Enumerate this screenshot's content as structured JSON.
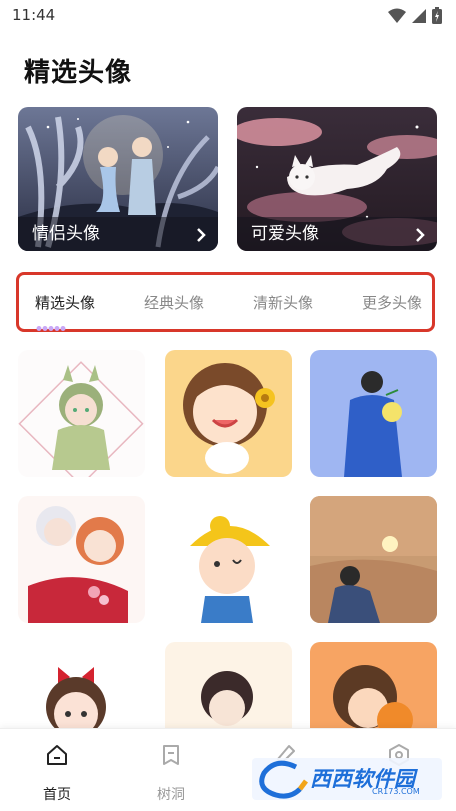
{
  "status_bar": {
    "time": "11:44"
  },
  "page_title": "精选头像",
  "banners": [
    {
      "label": "情侣头像",
      "icon": "chevron-right-icon"
    },
    {
      "label": "可爱头像",
      "icon": "chevron-right-icon"
    }
  ],
  "tabs": [
    {
      "label": "精选头像",
      "active": true
    },
    {
      "label": "经典头像",
      "active": false
    },
    {
      "label": "清新头像",
      "active": false
    },
    {
      "label": "更多头像",
      "active": false
    }
  ],
  "colors": {
    "highlight_border": "#d8372a",
    "indicator": "#c9a7f5",
    "watermark": "#1e6fd9"
  },
  "bottom_nav": [
    {
      "label": "首页",
      "icon": "home-icon",
      "active": true
    },
    {
      "label": "树洞",
      "icon": "note-icon",
      "active": false
    },
    {
      "label": "",
      "icon": "pen-icon",
      "active": false
    },
    {
      "label": "",
      "icon": "hexagon-icon",
      "active": false
    }
  ],
  "watermark": {
    "text": "西西软件园",
    "sub": "CR173.COM"
  }
}
